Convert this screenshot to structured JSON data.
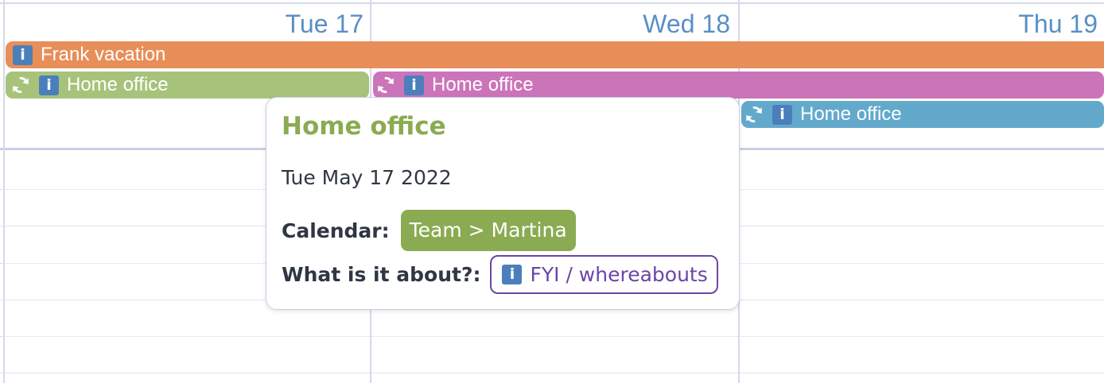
{
  "colors": {
    "header_text": "#5a8ec6",
    "vacation": "#e88e59",
    "home_office_tue": "#a7c37b",
    "home_office_wed": "#cc74ba",
    "home_office_thu": "#63a9cc",
    "calendar_badge": "#8aab52",
    "topic_badge": "#6b45a8",
    "info_icon": "#4a7fbb"
  },
  "days": [
    {
      "label": "Tue 17"
    },
    {
      "label": "Wed 18"
    },
    {
      "label": "Thu 19"
    }
  ],
  "events": {
    "vacation": {
      "title": "Frank vacation",
      "icons": [
        "info-icon"
      ]
    },
    "home_office_tue": {
      "title": "Home office",
      "icons": [
        "recurring-icon",
        "info-icon"
      ]
    },
    "home_office_wed": {
      "title": "Home office",
      "icons": [
        "recurring-icon",
        "info-icon"
      ]
    },
    "home_office_thu": {
      "title": "Home office",
      "icons": [
        "recurring-icon",
        "info-icon"
      ]
    }
  },
  "popup": {
    "title": "Home office",
    "date": "Tue May 17 2022",
    "calendar_label": "Calendar:",
    "calendar_value": "Team > Martina",
    "topic_label": "What is it about?:",
    "topic_value": "FYI / whereabouts",
    "topic_icon": "info-icon"
  }
}
